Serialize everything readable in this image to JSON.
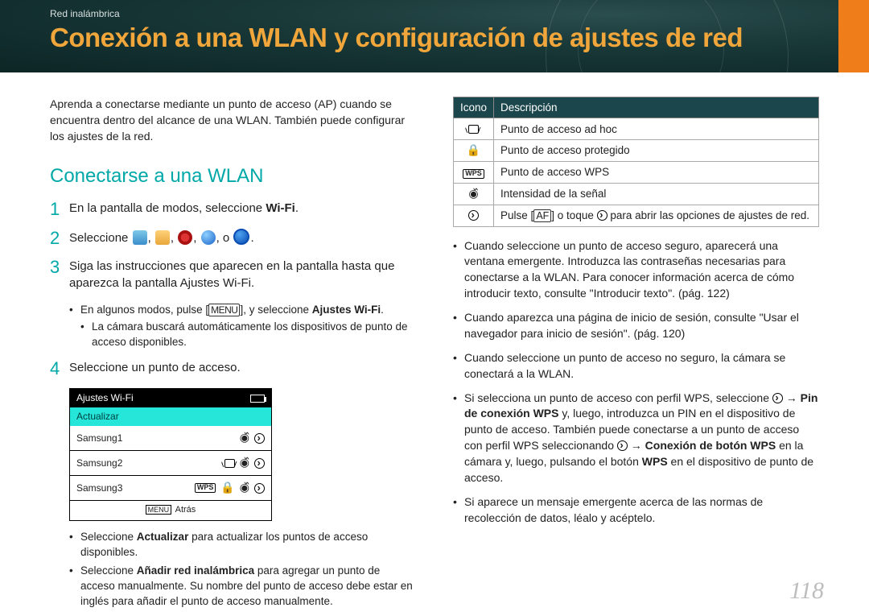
{
  "breadcrumb": "Red inalámbrica",
  "title": "Conexión a una WLAN y configuración de ajustes de red",
  "intro": "Aprenda a conectarse mediante un punto de acceso (AP) cuando se encuentra dentro del alcance de una WLAN. También puede configurar los ajustes de la red.",
  "subhead": "Conectarse a una WLAN",
  "steps": {
    "s1": "En la pantalla de modos, seleccione ",
    "s1_bold": "Wi-Fi",
    "s2_pre": "Seleccione ",
    "s2_sep": ", ",
    "s2_or": ", o ",
    "s3": "Siga las instrucciones que aparecen en la pantalla hasta que aparezca la pantalla Ajustes Wi-Fi.",
    "s3_sub1_a": "En algunos modos, pulse [",
    "s3_sub1_menu": "MENU",
    "s3_sub1_b": "], y seleccione ",
    "s3_sub1_bold": "Ajustes Wi-Fi",
    "s3_sub2": "La cámara buscará automáticamente los dispositivos de punto de acceso disponibles.",
    "s4": "Seleccione un punto de acceso."
  },
  "wifi_panel": {
    "header": "Ajustes Wi-Fi",
    "refresh": "Actualizar",
    "rows": [
      "Samsung1",
      "Samsung2",
      "Samsung3"
    ],
    "footer_menu": "MENU",
    "footer_back": "Atrás"
  },
  "post_panel": {
    "b1_a": "Seleccione ",
    "b1_bold": "Actualizar",
    "b1_b": " para actualizar los puntos de acceso disponibles.",
    "b2_a": "Seleccione ",
    "b2_bold": "Añadir red inalámbrica",
    "b2_b": " para agregar un punto de acceso manualmente. Su nombre del punto de acceso debe estar en inglés para añadir el punto de acceso manualmente."
  },
  "table": {
    "h1": "Icono",
    "h2": "Descripción",
    "r1": "Punto de acceso ad hoc",
    "r2": "Punto de acceso protegido",
    "r3": "Punto de acceso WPS",
    "r4": "Intensidad de la señal",
    "r5_a": "Pulse [",
    "r5_af": "AF",
    "r5_b": "] o toque ",
    "r5_c": " para abrir las opciones de ajustes de red."
  },
  "right_bullets": {
    "b1": "Cuando seleccione un punto de acceso seguro, aparecerá una ventana emergente. Introduzca las contraseñas necesarias para conectarse a la WLAN. Para conocer información acerca de cómo introducir texto, consulte \"Introducir texto\". (pág. 122)",
    "b2": "Cuando aparezca una página de inicio de sesión, consulte \"Usar el navegador para inicio de sesión\". (pág. 120)",
    "b3": "Cuando seleccione un punto de acceso no seguro, la cámara se conectará a la WLAN.",
    "b4_a": "Si selecciona un punto de acceso con perfil WPS, seleccione ",
    "b4_arrow": " → ",
    "b4_bold1": "Pin de conexión WPS",
    "b4_b": " y, luego, introduzca un PIN en el dispositivo de punto de acceso. También puede conectarse a un punto de acceso con perfil WPS seleccionando ",
    "b4_bold2": "Conexión de botón WPS",
    "b4_c": " en la cámara y, luego, pulsando el botón ",
    "b4_bold3": "WPS",
    "b4_d": " en el dispositivo de punto de acceso.",
    "b5": "Si aparece un mensaje emergente acerca de las normas de recolección de datos, léalo y acéptelo."
  },
  "page_number": "118"
}
